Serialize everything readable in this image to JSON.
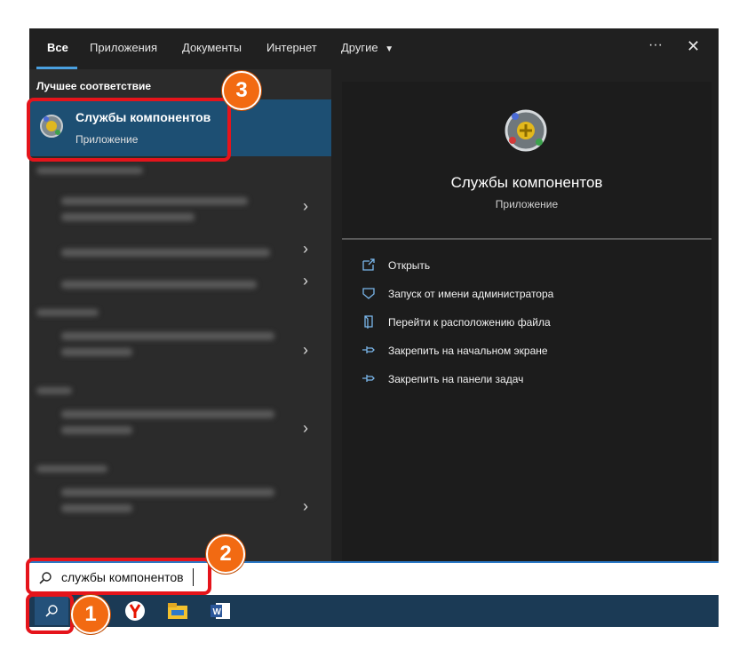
{
  "tabs": [
    "Все",
    "Приложения",
    "Документы",
    "Интернет",
    "Другие"
  ],
  "more_label": "···",
  "close_label": "✕",
  "best_match": {
    "section": "Лучшее соответствие",
    "title": "Службы компонентов",
    "subtitle": "Приложение"
  },
  "preview": {
    "title": "Службы компонентов",
    "subtitle": "Приложение",
    "actions": [
      {
        "label": "Открыть",
        "icon": "open-icon"
      },
      {
        "label": "Запуск от имени администратора",
        "icon": "admin-shield-icon"
      },
      {
        "label": "Перейти к расположению файла",
        "icon": "file-location-icon"
      },
      {
        "label": "Закрепить на начальном экране",
        "icon": "pin-icon"
      },
      {
        "label": "Закрепить на панели задач",
        "icon": "pin-icon"
      }
    ]
  },
  "search": {
    "value": "службы компонентов",
    "icon": "search-icon"
  },
  "taskbar": {
    "icons": [
      "search-icon",
      "yandex-browser-icon",
      "file-explorer-icon",
      "word-icon"
    ]
  },
  "badges": [
    "1",
    "2",
    "3"
  ],
  "colors": {
    "panel_bg": "#202020",
    "selection": "#1d4f73",
    "accent": "#4aa0e0",
    "highlight_border": "#e5141b",
    "badge": "#f26a12",
    "taskbar": "#1b3a55"
  }
}
